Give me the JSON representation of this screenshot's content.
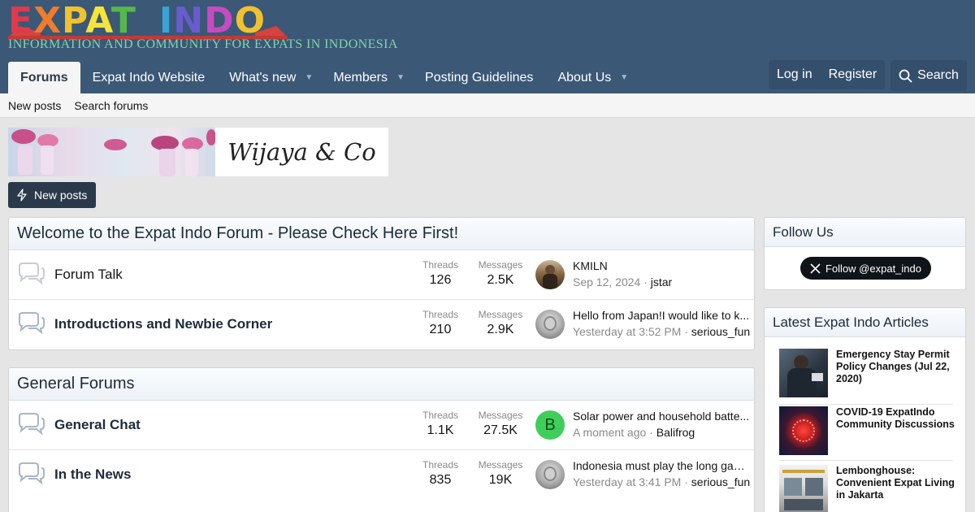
{
  "logo": {
    "letters": [
      "E",
      "X",
      "P",
      "A",
      "T",
      "I",
      "N",
      "D",
      "O"
    ],
    "tagline": "INFORMATION AND COMMUNITY FOR EXPATS IN INDONESIA"
  },
  "nav": {
    "tabs": [
      {
        "label": "Forums",
        "active": true
      },
      {
        "label": "Expat Indo Website"
      },
      {
        "label": "What's new"
      },
      {
        "label": "Members"
      },
      {
        "label": "Posting Guidelines"
      },
      {
        "label": "About Us"
      }
    ],
    "login": "Log in",
    "register": "Register",
    "search": "Search"
  },
  "subnav": {
    "new_posts": "New posts",
    "search_forums": "Search forums"
  },
  "banner": {
    "text": "Wijaya & Co"
  },
  "new_posts_button": "New posts",
  "categories": [
    {
      "title": "Welcome to the Expat Indo Forum - Please Check Here First!",
      "forums": [
        {
          "name": "Forum Talk",
          "bold": false,
          "threads_label": "Threads",
          "threads": "126",
          "messages_label": "Messages",
          "messages": "2.5K",
          "last_title": "KMILN",
          "last_time": "Sep 12, 2024",
          "last_user": "jstar"
        },
        {
          "name": "Introductions and Newbie Corner",
          "bold": true,
          "threads_label": "Threads",
          "threads": "210",
          "messages_label": "Messages",
          "messages": "2.9K",
          "last_title": "Hello from Japan!I would like to k...",
          "last_time": "Yesterday at 3:52 PM",
          "last_user": "serious_fun"
        }
      ]
    },
    {
      "title": "General Forums",
      "forums": [
        {
          "name": "General Chat",
          "bold": true,
          "threads_label": "Threads",
          "threads": "1.1K",
          "messages_label": "Messages",
          "messages": "27.5K",
          "last_title": "Solar power and household batte...",
          "last_time": "A moment ago",
          "last_user": "Balifrog",
          "avatar_letter": "B"
        },
        {
          "name": "In the News",
          "bold": true,
          "threads_label": "Threads",
          "threads": "835",
          "messages_label": "Messages",
          "messages": "19K",
          "last_title": "Indonesia must play the long gam...",
          "last_time": "Yesterday at 3:41 PM",
          "last_user": "serious_fun"
        }
      ]
    }
  ],
  "sidebar": {
    "follow": {
      "title": "Follow Us",
      "button": "Follow @expat_indo"
    },
    "articles": {
      "title": "Latest Expat Indo Articles",
      "items": [
        {
          "title": "Emergency Stay Permit Policy Changes (Jul 22, 2020)"
        },
        {
          "title": "COVID-19 ExpatIndo Community Discussions"
        },
        {
          "title": "Lembonghouse: Convenient Expat Living in Jakarta"
        }
      ]
    }
  },
  "colors": {
    "header": "#3b5876",
    "nav_active_bg": "#f5f5f5",
    "button_dark": "#2b3a4a",
    "avatar_green": "#3fce5a"
  }
}
